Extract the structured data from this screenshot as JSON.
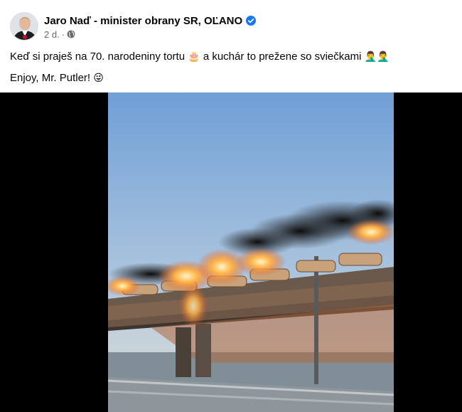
{
  "post": {
    "author_name": "Jaro Naď - minister obrany SR, OĽANO",
    "verified": true,
    "timestamp": "2 d.",
    "separator": "·",
    "privacy_icon": "globe-icon",
    "text_line1_a": "Keď si praješ na 70. narodeniny tortu",
    "emoji_cake": "🎂",
    "text_line1_b": "a kuchár to prežene so sviečkami",
    "emoji_facepalm": "🤦‍♂️🤦‍♂️",
    "text_line2": "Enjoy, Mr. Putler!",
    "emoji_wink": "😜"
  },
  "colors": {
    "verified_blue": "#1877f2",
    "meta_gray": "#65676b",
    "text": "#050505",
    "media_bg": "#000000"
  }
}
